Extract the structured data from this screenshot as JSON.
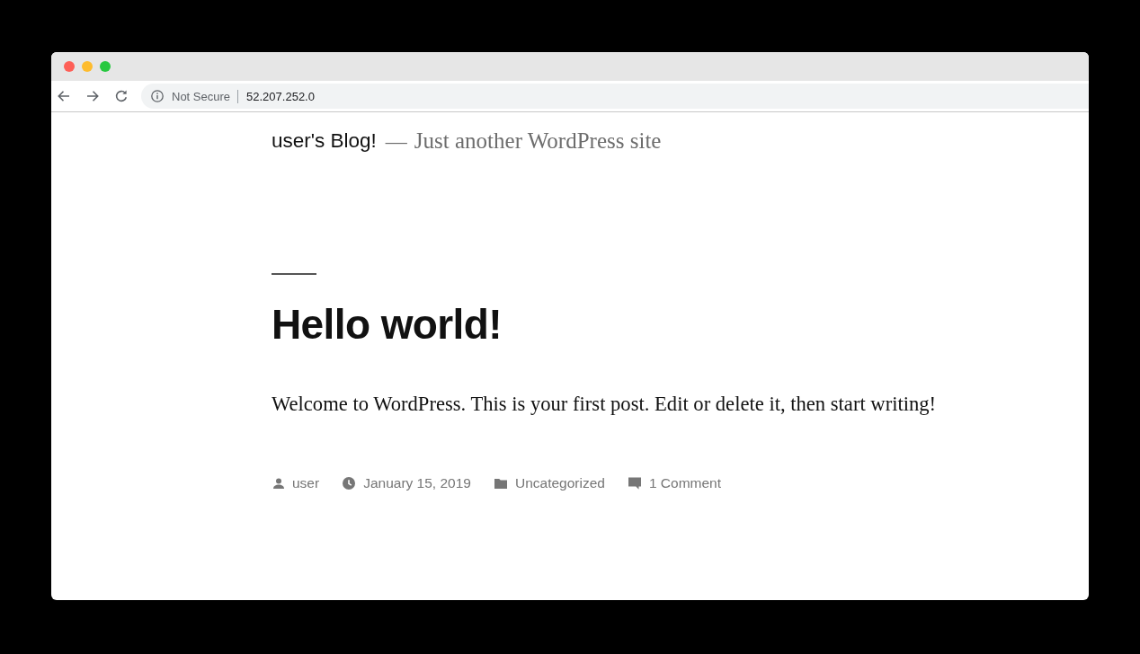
{
  "browser": {
    "window_buttons": [
      {
        "color": "#fe5f57"
      },
      {
        "color": "#febc2e"
      },
      {
        "color": "#28c840"
      }
    ],
    "address_bar": {
      "security_label": "Not Secure",
      "url": "52.207.252.0"
    }
  },
  "site_header": {
    "title": "user's Blog!",
    "separator": "—",
    "tagline": "Just another WordPress site"
  },
  "post": {
    "title": "Hello world!",
    "body": "Welcome to WordPress. This is your first post. Edit or delete it, then start writing!",
    "meta": [
      {
        "kind": "author",
        "text": "user"
      },
      {
        "kind": "date",
        "text": "January 15, 2019"
      },
      {
        "kind": "category",
        "text": "Uncategorized"
      },
      {
        "kind": "comments",
        "text": "1 Comment"
      }
    ]
  }
}
